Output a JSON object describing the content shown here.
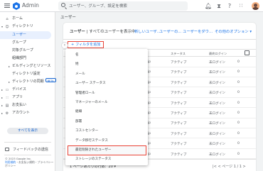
{
  "header": {
    "app_title": "Admin",
    "search_placeholder": "ユーザー、グループ、設定を検索",
    "icons": [
      "bell-icon",
      "hourglass-icon",
      "help-icon",
      "apps-grid-icon",
      "user-avatar"
    ]
  },
  "breadcrumb": "ユーザー",
  "sidebar": {
    "items": [
      {
        "label": "ホーム",
        "icon": "home-icon"
      },
      {
        "label": "ディレクトリ",
        "icon": "people-icon"
      },
      {
        "label": "ユーザー"
      },
      {
        "label": "グループ"
      },
      {
        "label": "対象グループ"
      },
      {
        "label": "組織部門"
      },
      {
        "label": "ビルディングとリソース"
      },
      {
        "label": "ディレクトリ設定"
      },
      {
        "label": "ディレクトリの同期"
      },
      {
        "label": "デバイス",
        "icon": "devices-icon"
      },
      {
        "label": "アプリ",
        "icon": "apps-icon"
      },
      {
        "label": "お支払い",
        "icon": "billing-icon"
      },
      {
        "label": "アカウント",
        "icon": "account-icon"
      }
    ],
    "beta_badge": "BETA",
    "more_button": "すべてを表示",
    "feedback": "フィードバックの送信",
    "footer_line1": "© 2023 Google Inc.",
    "footer_line2a": "利用規約",
    "footer_line2b": "・お支払い規約・プライバシー ポリシー"
  },
  "card": {
    "title_bold": "ユーザー",
    "title_rest": " | すべてのユーザーを表示中",
    "links": [
      "新しいユーザ...",
      "ユーザーの...",
      "ユーザーをダウ...",
      "その他のオプション ▾"
    ],
    "add_filter": "フィルタを追加",
    "columns": [
      "ステータス",
      "最終ログイン"
    ],
    "rows": [
      {
        "email": "@gmail.jp",
        "status": "アクティブ",
        "login": "未ログイン",
        "storage": "0"
      },
      {
        "email": "@gmail.jp",
        "status": "アクティブ",
        "login": "未ログイン",
        "storage": "0"
      },
      {
        "email": "@gmail.jp",
        "status": "アクティブ",
        "login": "未ログイン",
        "storage": "0"
      },
      {
        "email": "@gmail.jp",
        "status": "アクティブ",
        "login": "未ログイン",
        "storage": "0"
      },
      {
        "email": "@gmail.jp",
        "status": "アクティブ",
        "login": "未ログイン",
        "storage": "0"
      },
      {
        "email": "@gmail.jp",
        "status": "アクティブ",
        "login": "未ログイン",
        "storage": "0"
      },
      {
        "email": "@gmail.jp",
        "status": "アクティブ",
        "login": "未ログイン",
        "storage": "0"
      },
      {
        "email": "@gmail.jp",
        "status": "アクティブ",
        "login": "未ログイン",
        "storage": "0"
      },
      {
        "email": "@gmail.jp",
        "status": "アクティブ",
        "login": "未ログイン",
        "storage": "0"
      },
      {
        "email": "@gmail.jp",
        "status": "アクティブ",
        "login": "未ログイン",
        "storage": "0"
      }
    ],
    "rows_per_page_label": "1 ページあたりの行数:",
    "rows_per_page_value": "20 ▾",
    "pager": "|<   <   ページ 1 / 1   >"
  },
  "filter_menu": {
    "items": [
      "名",
      "姓",
      "メール",
      "ユーザー ステータス",
      "管理者ロール",
      "マネージャーのメール",
      "組織",
      "部署",
      "コストセンター",
      "データ移行ステータス",
      "最近削除されたユーザー",
      "ストレージのステータス"
    ],
    "selected_index": 10
  },
  "colors": {
    "accent": "#1a73e8",
    "highlight": "#e94235",
    "active_nav_bg": "#e8f0fe"
  }
}
